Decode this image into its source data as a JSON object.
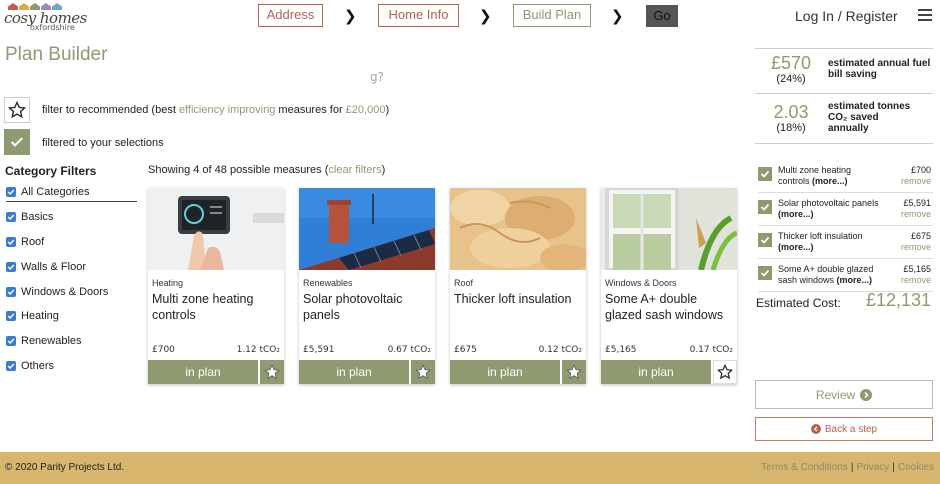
{
  "brand": {
    "logo_main": "cosy homes",
    "logo_sub": "oxfordshire",
    "house_colors": [
      "#c95b4a",
      "#e0a94a",
      "#8f9a70",
      "#9b8ab4",
      "#6fa3c7"
    ]
  },
  "nav": {
    "steps": [
      {
        "label": "Address",
        "color": "#b5624f"
      },
      {
        "label": "Home Info",
        "color": "#b5624f"
      },
      {
        "label": "Build Plan",
        "color": "#8f9a70"
      }
    ],
    "go_label": "Go",
    "login_label": "Log In / Register"
  },
  "page_title": "Plan Builder",
  "ghost_text": "g?",
  "filters": {
    "recommended_prefix": "filter to recommended (best ",
    "recommended_highlight": "efficiency improving",
    "recommended_mid": " measures for ",
    "recommended_amount": "£20,000",
    "recommended_suffix": ")",
    "selected_label": "filtered to your selections"
  },
  "categories": {
    "title": "Category Filters",
    "items": [
      "All Categories",
      "Basics",
      "Roof",
      "Walls & Floor",
      "Windows & Doors",
      "Heating",
      "Renewables",
      "Others"
    ]
  },
  "results": {
    "showing": "Showing 4 of 48 possible measures (",
    "clear_label": "clear filters",
    "close_paren": ")"
  },
  "measures": [
    {
      "category": "Heating",
      "name": "Multi zone heating controls",
      "cost": "£700",
      "co2": "1.12 tCO₂",
      "plan_label": "in plan",
      "starred": true,
      "image": "thermostat-photo"
    },
    {
      "category": "Renewables",
      "name": "Solar photovoltaic panels",
      "cost": "£5,591",
      "co2": "0.67 tCO₂",
      "plan_label": "in plan",
      "starred": true,
      "image": "solar-roof-photo"
    },
    {
      "category": "Roof",
      "name": "Thicker loft insulation",
      "cost": "£675",
      "co2": "0.12 tCO₂",
      "plan_label": "in plan",
      "starred": true,
      "image": "insulation-photo"
    },
    {
      "category": "Windows & Doors",
      "name": "Some A+ double glazed sash windows",
      "cost": "£5,165",
      "co2": "0.17 tCO₂",
      "plan_label": "in plan",
      "starred": false,
      "image": "window-photo"
    }
  ],
  "summary": {
    "bill_value": "£570",
    "bill_pct": "(24%)",
    "bill_label": "estimated annual fuel bill saving",
    "co2_value": "2.03",
    "co2_pct": "(18%)",
    "co2_label_1": "estimated tonnes",
    "co2_label_2": "CO₂ saved",
    "co2_label_3": "annually"
  },
  "selections": [
    {
      "name": "Multi zone heating controls",
      "more": "(more...)",
      "price": "£700",
      "remove": "remove"
    },
    {
      "name": "Solar photovoltaic panels",
      "more": "(more...)",
      "price": "£5,591",
      "remove": "remove"
    },
    {
      "name": "Thicker loft insulation",
      "more": "(more...)",
      "price": "£675",
      "remove": "remove"
    },
    {
      "name": "Some A+ double glazed sash windows",
      "more": "(more...)",
      "price": "£5,165",
      "remove": "remove"
    }
  ],
  "estimated": {
    "label": "Estimated Cost:",
    "value": "£12,131"
  },
  "actions": {
    "review_label": "Review",
    "back_label": "Back a step"
  },
  "footer": {
    "copyright": "© 2020 Parity Projects Ltd.",
    "links": [
      "Terms & Conditions",
      "Privacy",
      "Cookies"
    ],
    "sep": "|"
  },
  "colors": {
    "accent_green": "#8f9a70",
    "accent_red": "#b5624f",
    "footer_gold": "#d9b66d",
    "checkbox_blue": "#3b7bd6"
  }
}
